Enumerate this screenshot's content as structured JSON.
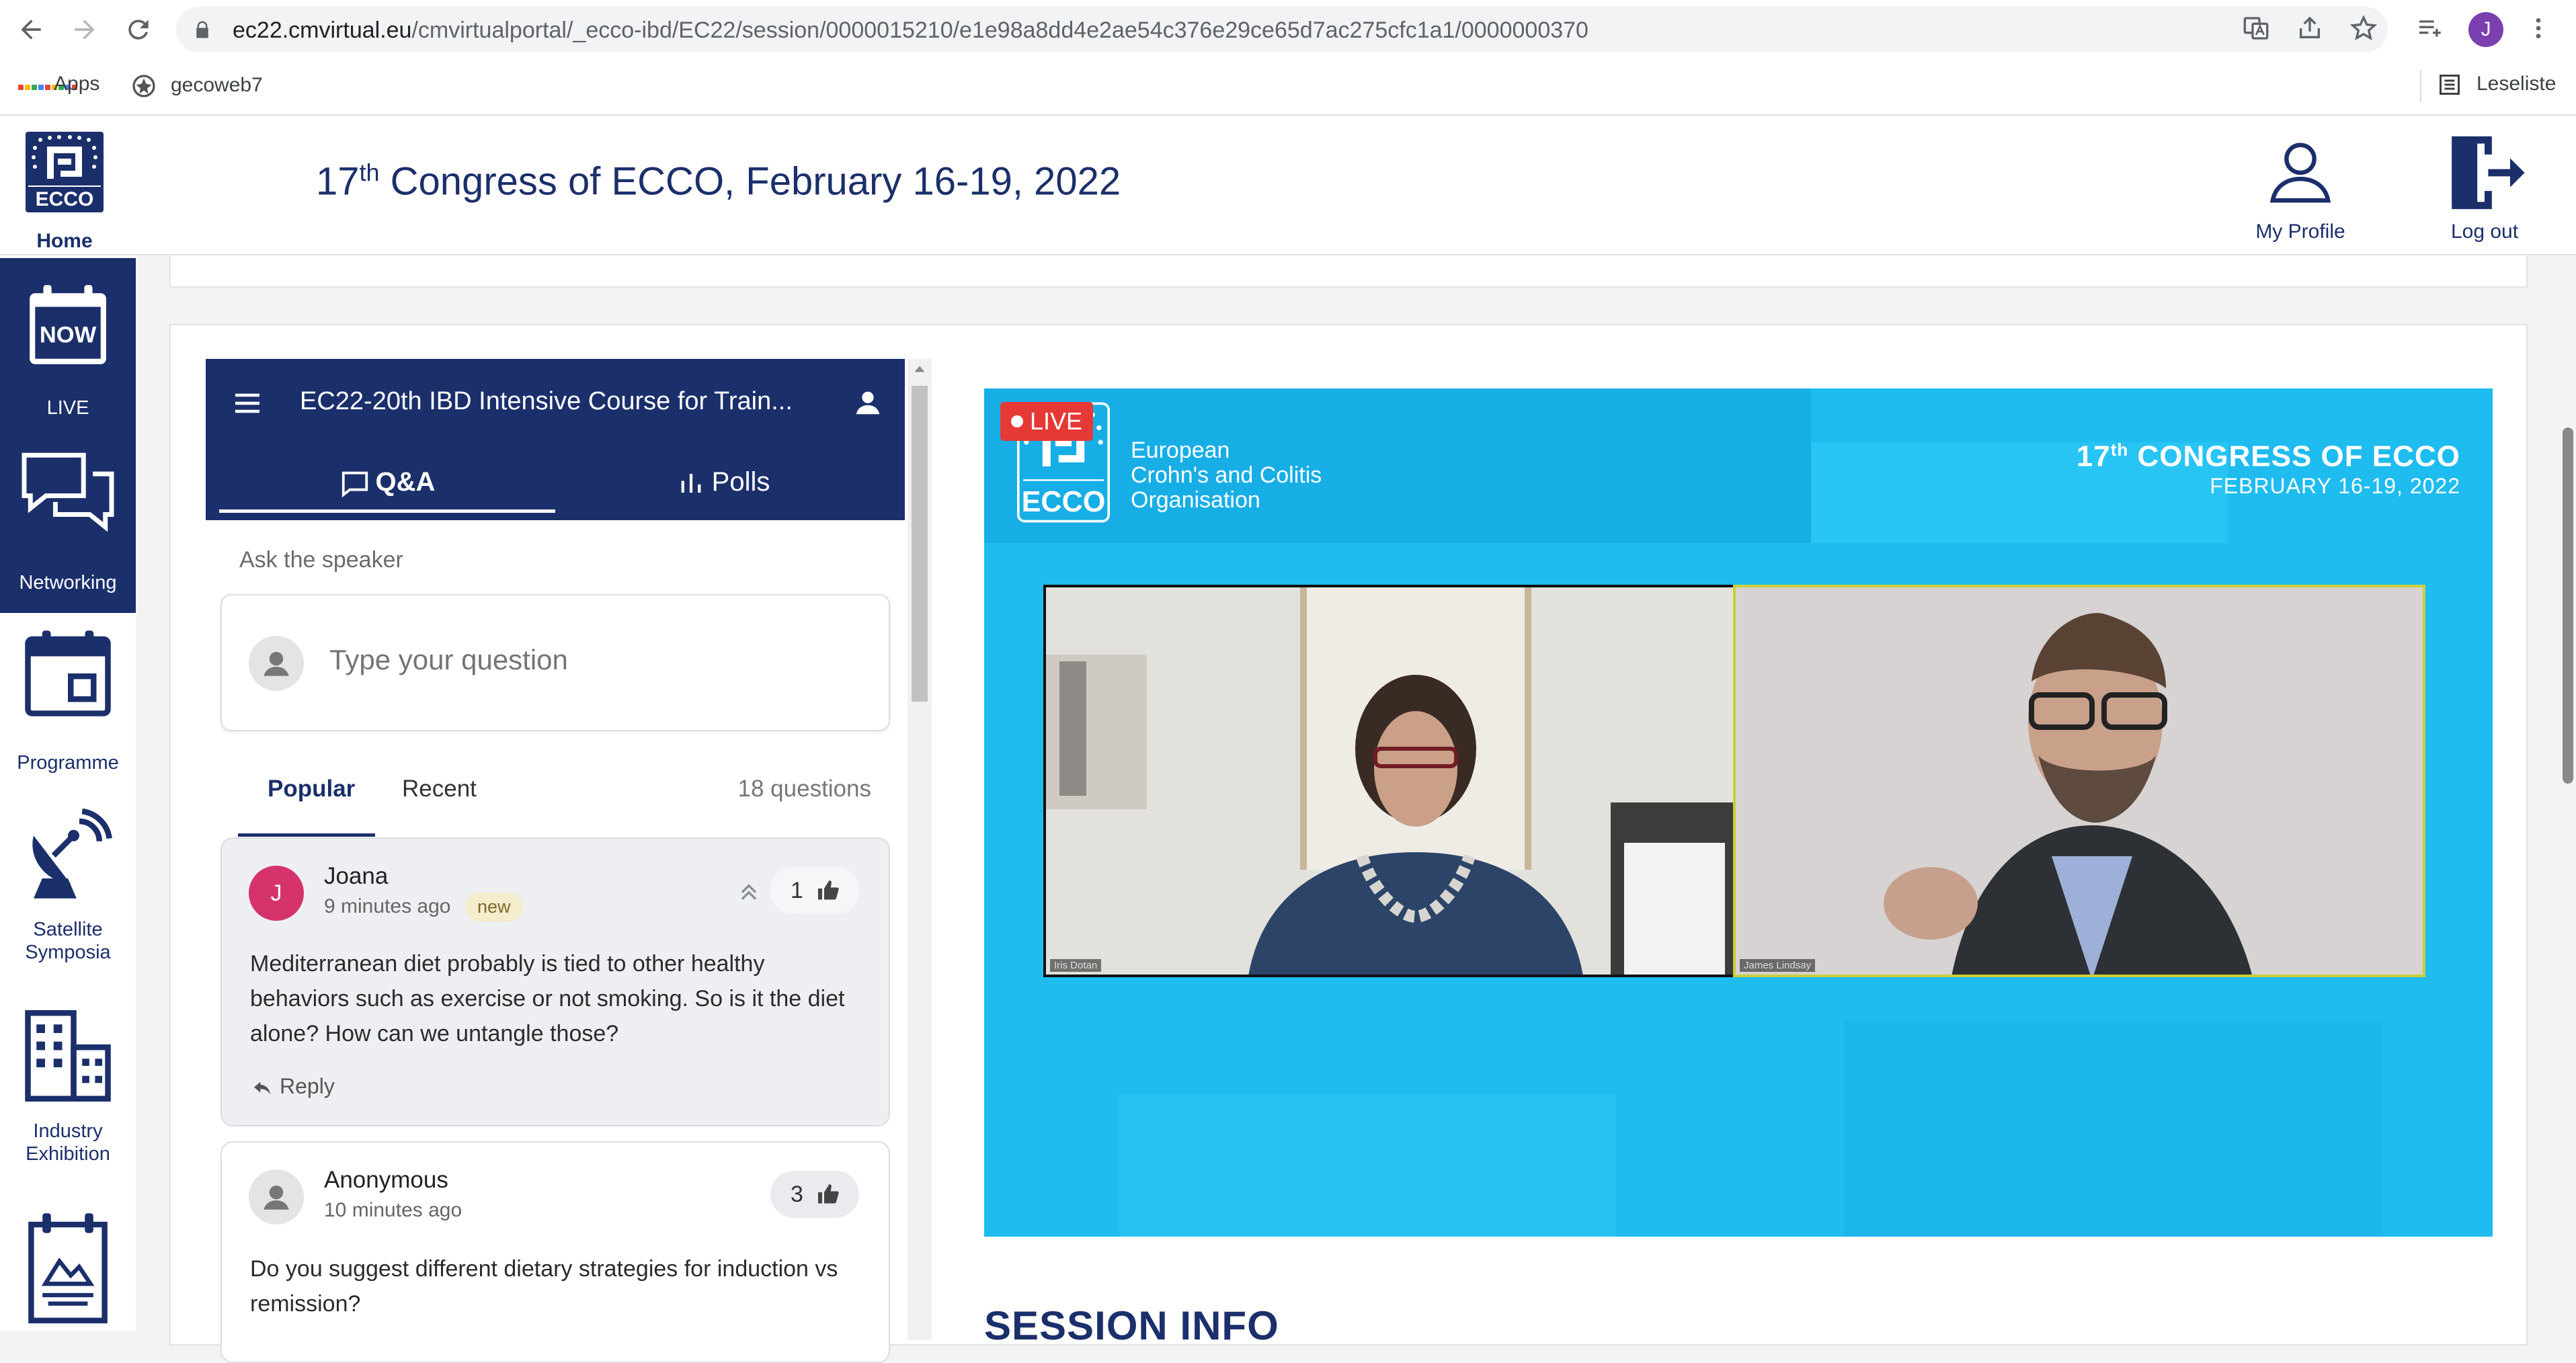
{
  "browser": {
    "url_host": "ec22.cmvirtual.eu",
    "url_path": "/cmvirtualportal/_ecco-ibd/EC22/session/0000015210/e1e98a8dd4e2ae54c376e29ce65d7ac275cfc1a1/0000000370",
    "profile_initial": "J",
    "bookmarks": [
      "Apps",
      "gecoweb7"
    ],
    "reading_list": "Leseliste"
  },
  "header": {
    "logo_home": "Home",
    "title_prefix": "17",
    "title_sup": "th",
    "title_rest": " Congress of ECCO, February 16-19, 2022",
    "my_profile": "My Profile",
    "log_out": "Log out"
  },
  "sidebar": {
    "items": [
      {
        "label": "LIVE",
        "icon": "now-calendar-icon"
      },
      {
        "label": "Networking",
        "icon": "chat-bubbles-icon"
      },
      {
        "label": "Programme",
        "icon": "calendar-icon"
      },
      {
        "label": "Satellite",
        "label2": "Symposia",
        "icon": "satellite-dish-icon"
      },
      {
        "label": "Industry",
        "label2": "Exhibition",
        "icon": "buildings-icon"
      },
      {
        "label": "",
        "icon": "poster-calendar-icon"
      }
    ],
    "now_text": "NOW"
  },
  "qa": {
    "session_title": "EC22-20th IBD Intensive Course for Train...",
    "tabs": [
      "Q&A",
      "Polls"
    ],
    "ask_label": "Ask the speaker",
    "input_placeholder": "Type your question",
    "sort_popular": "Popular",
    "sort_recent": "Recent",
    "question_count": "18 questions",
    "questions": [
      {
        "initial": "J",
        "name": "Joana",
        "time": "9 minutes ago",
        "badge": "new",
        "likes": "1",
        "text": "Mediterranean diet probably is tied to other healthy behaviors such as exercise or not smoking. So is it the diet alone? How can we untangle those?",
        "reply": "Reply"
      },
      {
        "initial": "",
        "name": "Anonymous",
        "time": "10 minutes ago",
        "likes": "3",
        "text": "Do you suggest different dietary strategies for induction vs remission?"
      }
    ]
  },
  "video": {
    "live": "LIVE",
    "org_line1": "European",
    "org_line2": "Crohn's and Colitis",
    "org_line3": "Organisation",
    "logo_text": "ECCO",
    "congress_prefix": "17",
    "congress_sup": "th",
    "congress_rest": " CONGRESS OF ECCO",
    "congress_dates": "FEBRUARY 16-19, 2022",
    "speaker_left": "Iris Dotan",
    "speaker_right": "James Lindsay"
  },
  "session_info": "SESSION INFO",
  "colors": {
    "brand_navy": "#1b2f6b",
    "video_blue": "#1fbcf0",
    "live_red": "#e53935",
    "avatar_pink": "#d6336c"
  }
}
